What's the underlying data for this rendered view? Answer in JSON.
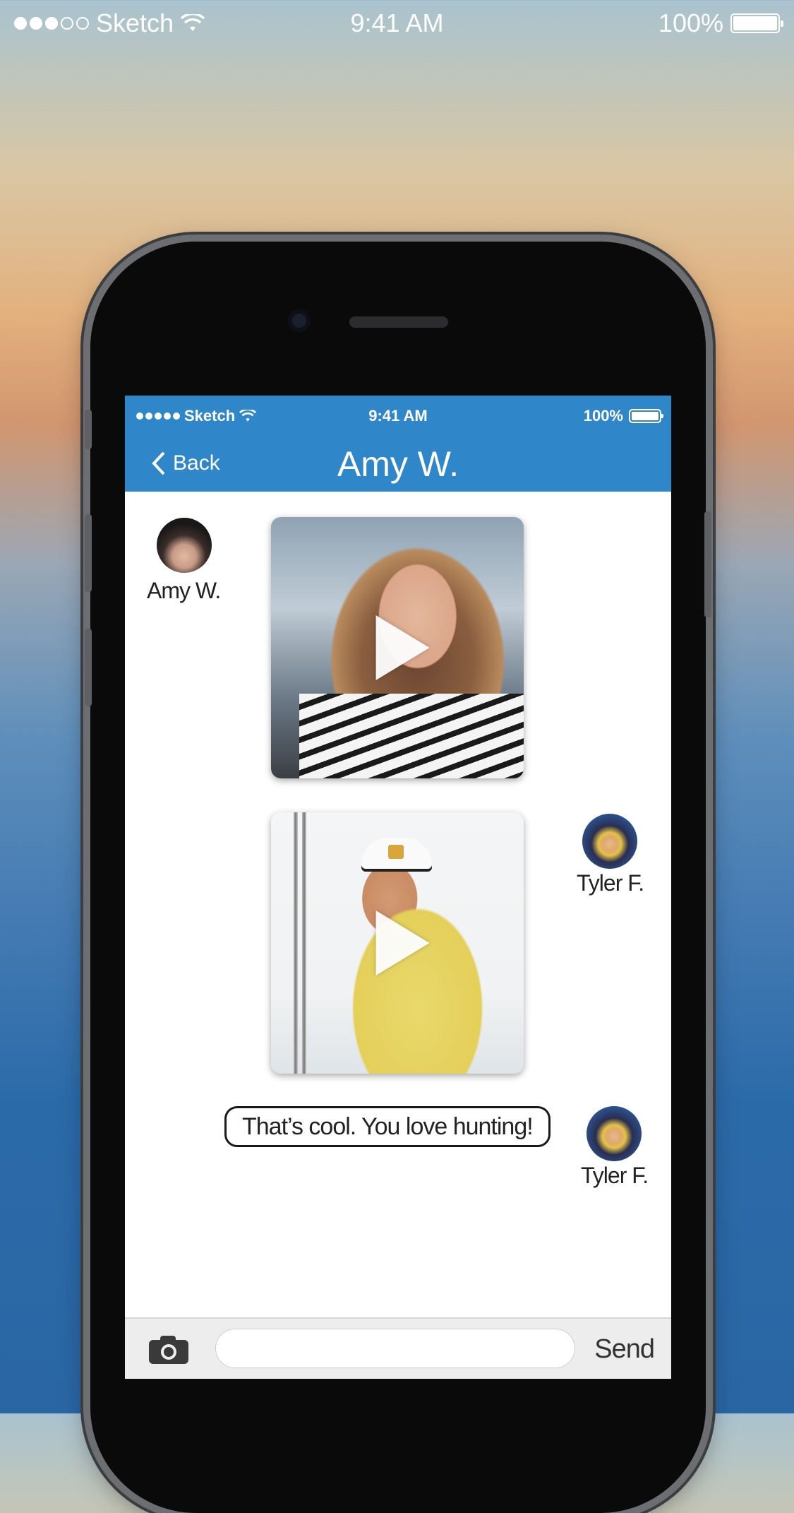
{
  "outer_status": {
    "carrier": "Sketch",
    "time": "9:41 AM",
    "battery": "100%",
    "signal_bars": 3,
    "signal_total": 5
  },
  "inner_status": {
    "carrier": "Sketch",
    "time": "9:41 AM",
    "battery": "100%"
  },
  "nav": {
    "back_label": "Back",
    "title": "Amy W."
  },
  "messages": [
    {
      "type": "video",
      "sender": "Amy W.",
      "side": "left"
    },
    {
      "type": "video",
      "sender": "Tyler F.",
      "side": "right"
    },
    {
      "type": "text",
      "sender": "Tyler F.",
      "side": "right",
      "text": "That’s cool. You love hunting!"
    }
  ],
  "composer": {
    "value": "",
    "send_label": "Send",
    "camera_icon": "camera-icon"
  },
  "colors": {
    "nav_bar": "#2f86c8",
    "screen_bg": "#ffffff",
    "composer_bg": "#ededed"
  }
}
